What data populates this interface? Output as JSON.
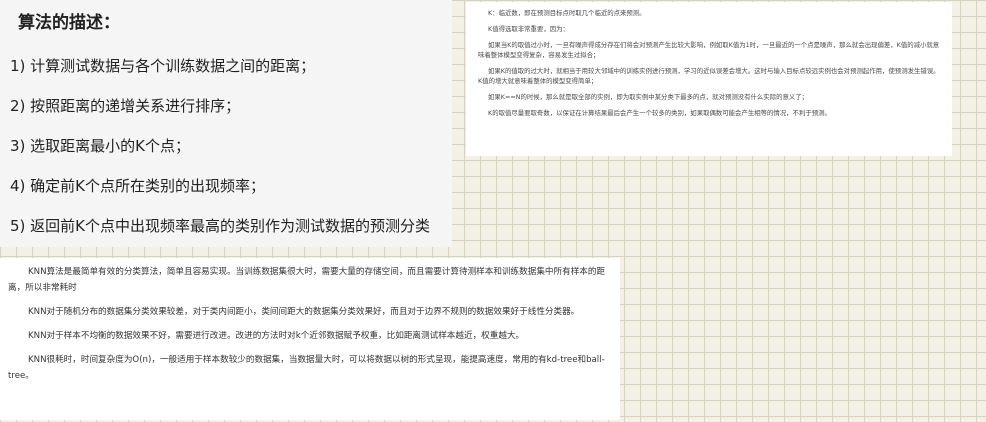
{
  "left_panel": {
    "title": "算法的描述：",
    "steps": [
      "1) 计算测试数据与各个训练数据之间的距离；",
      "2) 按照距离的递增关系进行排序；",
      "3) 选取距离最小的K个点；",
      "4) 确定前K个点所在类别的出现频率；",
      "5) 返回前K个点中出现频率最高的类别作为测试数据的预测分类"
    ]
  },
  "right_panel": {
    "paragraphs": [
      "K：临近数，即在预测目标点时取几个临近的点来预测。",
      "K值得选取非常重要，因为：",
      "如果当K的取值过小时，一旦有噪声得成分存在们将会对预测产生比较大影响，例如取K值为1时，一旦最近的一个点是噪声，那么就会出现偏差，K值的减小就意味着整体模型变得复杂，容易发生过拟合；",
      "如果K的值取的过大时，就相当于用较大邻域中的训练实例进行预测，学习的近似误差会增大。这时与输入目标点较远实例也会对预测起作用，使预测发生错误。K值的增大就意味着整体的模型变得简单；",
      "如果K==N的时候，那么就是取全部的实例，即为取实例中某分类下最多的点，就对预测没有什么实际的意义了；",
      "K的取值尽量要取奇数，以保证在计算结果最后会产生一个较多的类别，如果取偶数可能会产生相等的情况，不利于预测。"
    ]
  },
  "bottom_panel": {
    "paragraphs": [
      "KNN算法是最简单有效的分类算法，简单且容易实现。当训练数据集很大时，需要大量的存储空间，而且需要计算待测样本和训练数据集中所有样本的距离，所以非常耗时",
      "KNN对于随机分布的数据集分类效果较差，对于类内间距小，类间间距大的数据集分类效果好，而且对于边界不规则的数据效果好于线性分类器。",
      "KNN对于样本不均衡的数据效果不好，需要进行改进。改进的方法时对k个近邻数据赋予权重，比如距离测试样本越近，权重越大。",
      "KNN很耗时，时间复杂度为O(n)，一般适用于样本数较少的数据集，当数据量大时，可以将数据以树的形式呈现，能提高速度，常用的有kd-tree和ball-tree。"
    ]
  }
}
